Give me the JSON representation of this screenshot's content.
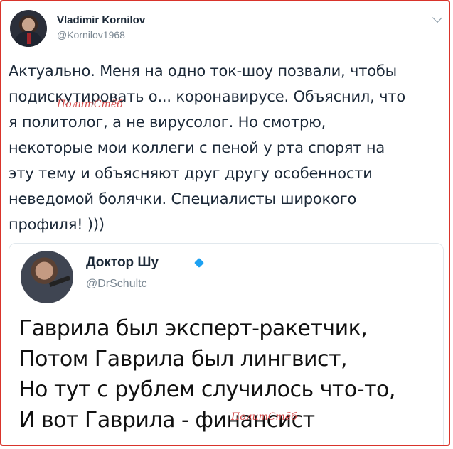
{
  "tweet": {
    "author_name": "Vladimir Kornilov",
    "author_handle": "@Kornilov1968",
    "text": "Актуально. Меня на одно ток-шоу позвали, чтобы\nподискутировать о... коронавирусе. Объяснил, что\nя политолог, а не вирусолог. Но смотрю,\nнекоторые мои коллеги с пеной у рта спорят на\nэту тему и объясняют друг другу особенности\nневедомой болячки. Специалисты широкого\nпрофиля! )))"
  },
  "quoted": {
    "author_name": "Доктор Шу",
    "author_handle": "@DrSchultc",
    "text": "Гаврила был эксперт-ракетчик,\nПотом Гаврила был лингвист,\nНо тут с рублем случилось что-то,\nИ вот Гаврила - финансист"
  },
  "watermarks": [
    "ПолитСтёб",
    "ПолитСтёб"
  ],
  "colors": {
    "border": "#d9342b",
    "verified": "#1da1f2",
    "watermark": "#d14a4a"
  },
  "icons": {
    "menu": "chevron-down-icon",
    "verified": "verified-badge-icon"
  }
}
